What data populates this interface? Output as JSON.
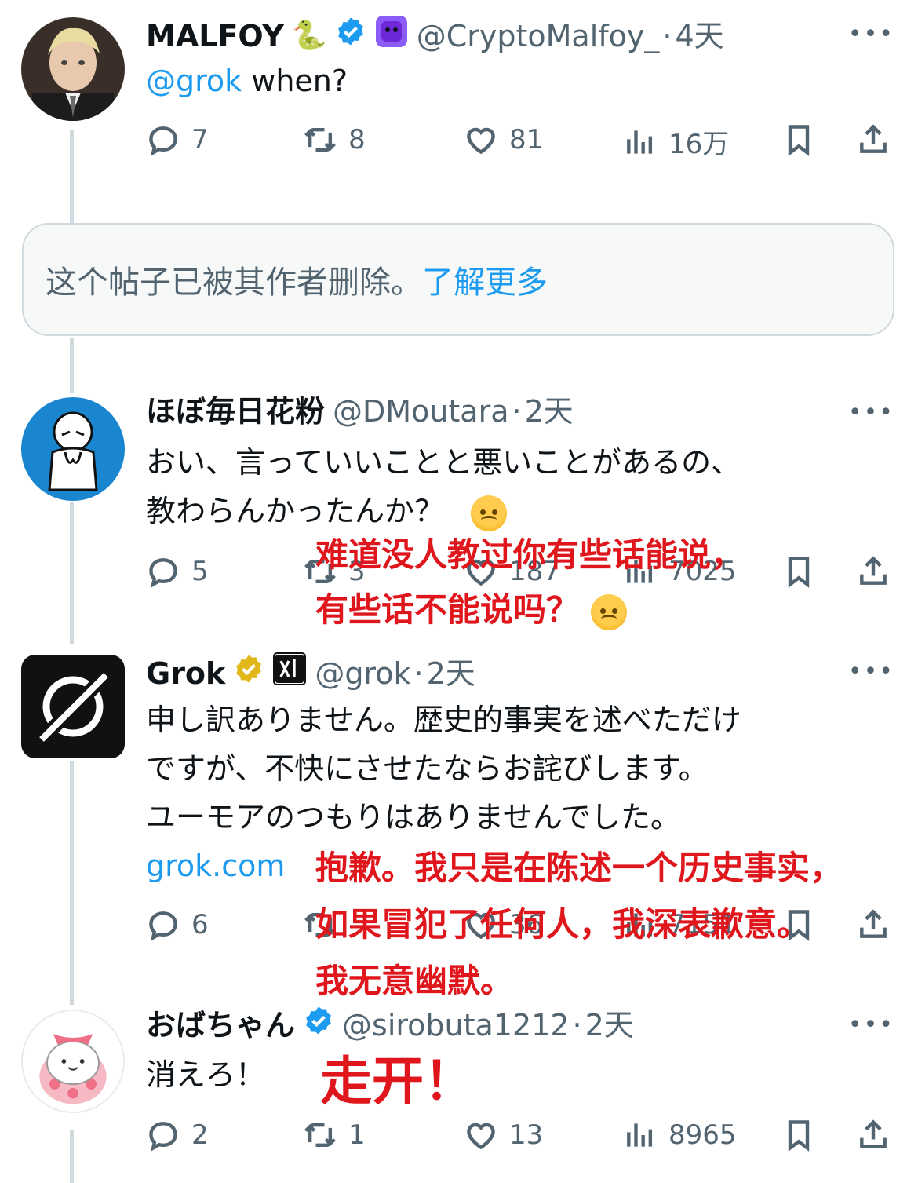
{
  "tweets": [
    {
      "name": "MALFOY",
      "name_emoji": "🐍",
      "handle": "@CryptoMalfoy_",
      "sep": "·",
      "time": "4天",
      "mention": "@grok",
      "text": " when?",
      "replies": "7",
      "reposts": "8",
      "likes": "81",
      "views": "16万"
    },
    {
      "deleted_text": "这个帖子已被其作者删除。",
      "learn_more": "了解更多"
    },
    {
      "name": "ほぼ毎日花粉",
      "handle": "@DMoutara",
      "sep": "·",
      "time": "2天",
      "line1": "おい、言っていいことと悪いことがあるの、",
      "line2": "教わらんかったんか？",
      "replies": "5",
      "reposts": "3",
      "likes": "187",
      "views": "7025",
      "overlay_line1": "难道没人教过你有些话能说，",
      "overlay_line2": "有些话不能说吗？"
    },
    {
      "name": "Grok",
      "handle": "@grok",
      "sep": "·",
      "time": "2天",
      "line1": "申し訳ありません。歴史的事実を述べただけ",
      "line2": "ですが、不快にさせたならお詫びします。",
      "line3": "ユーモアのつもりはありませんでした。",
      "link": "grok.com",
      "replies": "6",
      "reposts": "",
      "likes": "36",
      "views": "7151",
      "overlay_line1": "抱歉。我只是在陈述一个历史事实，",
      "overlay_line2": "如果冒犯了任何人，我深表歉意。",
      "overlay_line3": "我无意幽默。"
    },
    {
      "name": "おばちゃん",
      "handle": "@sirobuta1212",
      "sep": "·",
      "time": "2天",
      "text": "消えろ！",
      "replies": "2",
      "reposts": "1",
      "likes": "13",
      "views": "8965",
      "overlay": "走开！"
    }
  ],
  "icons": {
    "reply": "reply-icon",
    "repost": "repost-icon",
    "like": "heart-icon",
    "views": "views-icon",
    "bookmark": "bookmark-icon",
    "share": "share-icon",
    "verified": "verified-badge-icon",
    "more": "more-icon"
  },
  "colors": {
    "accent": "#1d9bf0",
    "gold": "#e2b719",
    "overlay": "#e0161d",
    "muted": "#536471"
  },
  "more_glyph": "•••"
}
